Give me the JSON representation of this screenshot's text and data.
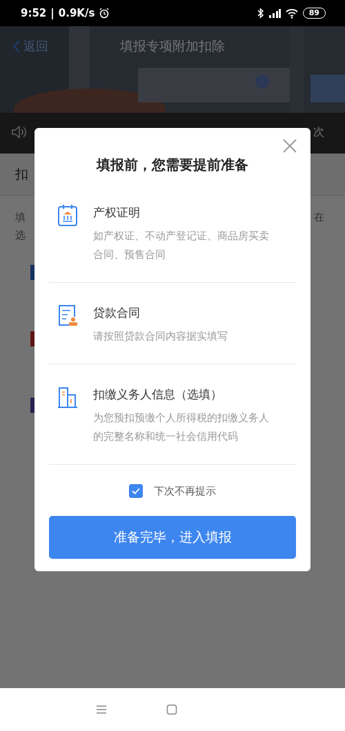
{
  "status_bar": {
    "time": "9:52",
    "separator": "|",
    "speed": "0.9K/s",
    "battery": "89"
  },
  "page": {
    "back": "返回",
    "title": "填报专项附加扣除",
    "notice_fragment": "次",
    "section_fragment": "扣",
    "intro_left": [
      "填",
      "选"
    ],
    "intro_right": "在"
  },
  "dialog": {
    "title": "填报前，您需要提前准备",
    "items": [
      {
        "kind": "deed",
        "title": "产权证明",
        "description": "如产权证、不动产登记证、商品房买卖合同、预售合同"
      },
      {
        "kind": "contract",
        "title": "贷款合同",
        "description": "请按照贷款合同内容据实填写"
      },
      {
        "kind": "company",
        "title": "扣缴义务人信息（选填）",
        "description": "为您预扣预缴个人所得税的扣缴义务人的完整名称和统一社会信用代码"
      }
    ],
    "dont_remind": {
      "label": "下次不再提示",
      "checked": true
    },
    "button": "准备完毕，进入填报"
  }
}
